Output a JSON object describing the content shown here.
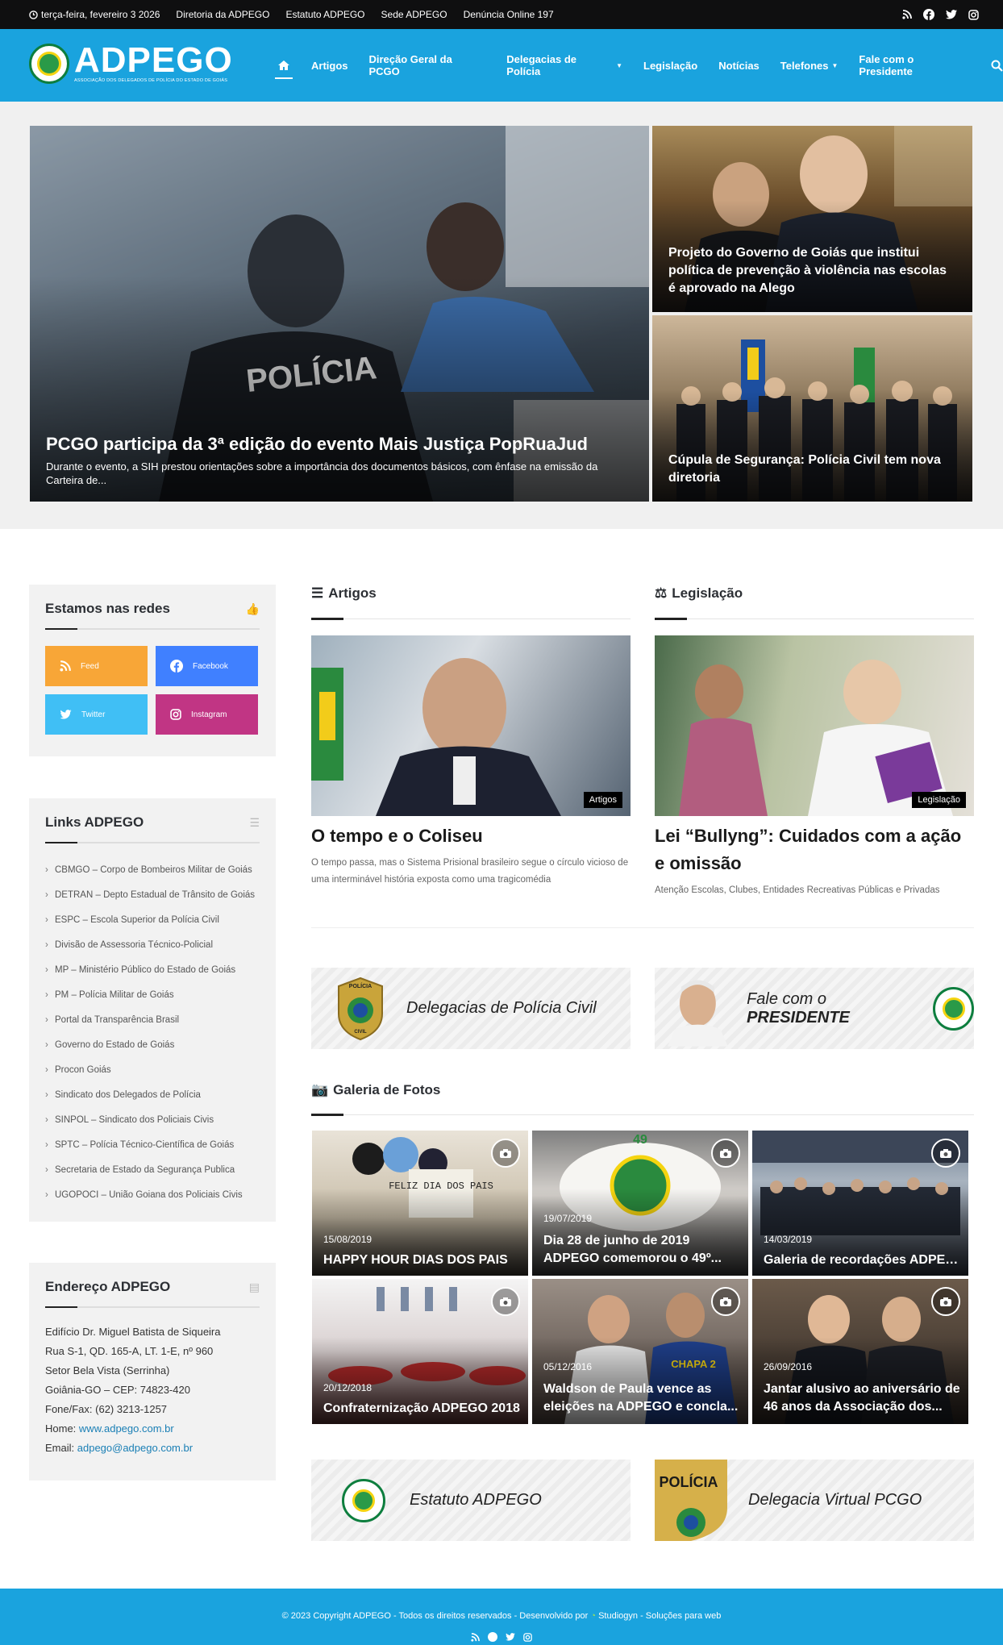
{
  "topbar": {
    "date": "terça-feira, fevereiro 3 2026",
    "links": [
      "Diretoria da ADPEGO",
      "Estatuto ADPEGO",
      "Sede ADPEGO",
      "Denúncia Online 197"
    ],
    "social_icons": [
      "rss-icon",
      "facebook-icon",
      "twitter-icon",
      "instagram-icon"
    ]
  },
  "header": {
    "logo_text": "ADPEGO",
    "logo_subtext": "ASSOCIAÇÃO DOS DELEGADOS DE POLÍCIA DO ESTADO DE GOIÁS",
    "nav": [
      "Artigos",
      "Direção Geral da PCGO",
      "Delegacias de Polícia",
      "Legislação",
      "Notícias",
      "Telefones",
      "Fale com o Presidente"
    ],
    "nav_dropdown": [
      "Delegacias de Polícia",
      "Telefones"
    ]
  },
  "hero": {
    "main": {
      "title": "PCGO participa da 3ª edição do evento Mais Justiça PopRuaJud",
      "excerpt": "Durante o evento, a SIH prestou orientações sobre a importância dos documentos básicos, com ênfase na emissão da Carteira de..."
    },
    "side": [
      {
        "title": "Projeto do Governo de Goiás que institui política de prevenção à violência nas escolas é aprovado na Alego"
      },
      {
        "title": "Cúpula de Segurança: Polícia Civil tem nova diretoria"
      }
    ]
  },
  "sidebar": {
    "social": {
      "title": "Estamos nas redes",
      "buttons": [
        {
          "label": "Feed",
          "color": "#f8a637"
        },
        {
          "label": "Facebook",
          "color": "#4080ff"
        },
        {
          "label": "Twitter",
          "color": "#40bff5"
        },
        {
          "label": "Instagram",
          "color": "#c13584"
        }
      ]
    },
    "links": {
      "title": "Links ADPEGO",
      "items": [
        "CBMGO – Corpo de Bombeiros Militar de Goiás",
        "DETRAN – Depto Estadual de Trânsito de Goiás",
        "ESPC – Escola Superior da Polícia Civil",
        "Divisão de Assessoria Técnico-Policial",
        "MP – Ministério Público do Estado de Goiás",
        "PM – Polícia Militar de Goiás",
        "Portal da Transparência Brasil",
        "Governo do Estado de Goiás",
        "Procon Goiás",
        "Sindicato dos Delegados de Polícia",
        "SINPOL – Sindicato dos Policiais Civis",
        "SPTC – Polícia Técnico-Científica de Goiás",
        "Secretaria de Estado da Segurança Publica",
        "UGOPOCI – União Goiana dos Policiais Civis"
      ]
    },
    "address": {
      "title": "Endereço ADPEGO",
      "lines": [
        "Edifício Dr. Miguel Batista de Siqueira",
        "Rua S-1, QD. 165-A, LT. 1-E, nº 960",
        "Setor Bela Vista (Serrinha)",
        "Goiânia-GO – CEP: 74823-420",
        "Fone/Fax: (62) 3213-1257"
      ],
      "home_label": "Home:",
      "home": "www.adpego.com.br",
      "email_label": "Email:",
      "email": "adpego@adpego.com.br"
    }
  },
  "sections": {
    "artigos": {
      "heading": "Artigos",
      "badge": "Artigos",
      "title": "O tempo e o Coliseu",
      "excerpt": "O tempo passa, mas o Sistema Prisional brasileiro segue o círculo vicioso de uma interminável história exposta como uma tragicomédia"
    },
    "legislacao": {
      "heading": "Legislação",
      "badge": "Legislação",
      "title": "Lei “Bullyng”: Cuidados com a ação e omissão",
      "excerpt": "Atenção Escolas, Clubes, Entidades Recreativas Públicas e Privadas"
    }
  },
  "banners": {
    "delegacias": "Delegacias de Polícia Civil",
    "presidente_a": "Fale com o ",
    "presidente_b": "PRESIDENTE",
    "estatuto": "Estatuto ADPEGO",
    "delegacia_virtual": "Delegacia Virtual PCGO",
    "police_badge_text": "POLÍCIA",
    "police_badge_text2": "CIVIL"
  },
  "gallery": {
    "heading": "Galeria de Fotos",
    "items": [
      {
        "date": "15/08/2019",
        "title": "HAPPY HOUR DIAS DOS PAIS",
        "sign": "FELIZ DIA DOS PAIS"
      },
      {
        "date": "19/07/2019",
        "title": "Dia 28 de junho de 2019 ADPEGO comemorou o 49º...",
        "sign": "49"
      },
      {
        "date": "14/03/2019",
        "title": "Galeria de recordações ADPEGO"
      },
      {
        "date": "20/12/2018",
        "title": "Confraternização ADPEGO 2018"
      },
      {
        "date": "05/12/2016",
        "title": "Waldson de Paula vence as eleições na ADPEGO e concla...",
        "sign": "CHAPA 2"
      },
      {
        "date": "26/09/2016",
        "title": "Jantar alusivo ao aniversário de 46 anos da Associação dos..."
      }
    ]
  },
  "footer": {
    "copyright": "© 2023 Copyright ADPEGO - Todos os direitos reservados - Desenvolvido por",
    "studio": "Studiogyn",
    "tagline": "- Soluções para web"
  },
  "colors": {
    "primary": "#1aa3de",
    "topbar": "#0f0f10"
  }
}
